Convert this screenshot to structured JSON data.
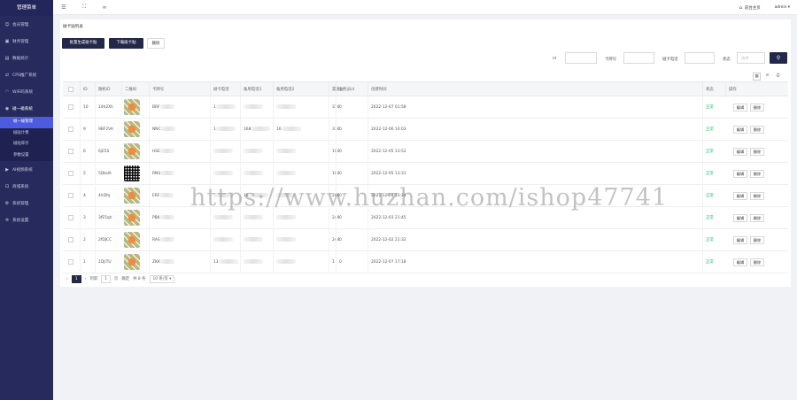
{
  "sidebar": {
    "title": "管理菜单",
    "items": [
      {
        "label": "会员管理",
        "icon": "user-group-icon"
      },
      {
        "label": "财务管理",
        "icon": "wallet-icon"
      },
      {
        "label": "数据统计",
        "icon": "chart-icon"
      },
      {
        "label": "CPS推广系统",
        "icon": "share-icon"
      },
      {
        "label": "WiFi码系统",
        "icon": "wifi-icon"
      },
      {
        "label": "碰一碰系统",
        "icon": "nfc-icon",
        "active": true
      },
      {
        "label": "AI视频系统",
        "icon": "video-icon"
      },
      {
        "label": "商城系统",
        "icon": "cart-icon"
      },
      {
        "label": "系统管理",
        "icon": "gear-icon"
      },
      {
        "label": "系统设置",
        "icon": "settings-icon"
      }
    ],
    "submenu": [
      "碰一碰管理",
      "碰贴计费",
      "碰贴库存",
      "参数设置"
    ],
    "active_sub": "碰一碰管理"
  },
  "topbar": {
    "icons": [
      "menu-icon",
      "fullscreen-icon",
      "link-icon"
    ],
    "home_label": "前台主页",
    "user_label": "admin"
  },
  "page": {
    "title": "碰卡贴列表",
    "buttons": {
      "batch_generate": "批量生成碰卡贴",
      "download": "下载碰卡贴",
      "delete": "删除"
    },
    "filters": {
      "id_label": "id",
      "card_label": "卡牌号",
      "phone_label": "碰卡电话",
      "status_label": "状态",
      "status_placeholder": "选择"
    }
  },
  "table": {
    "headers": [
      "ID",
      "随机ID",
      "二维码",
      "卡牌号",
      "碰卡电话",
      "备用电话1",
      "备用电话2",
      "渠道id",
      "业务员id",
      "创建时间",
      "状态",
      "操作"
    ],
    "rows": [
      {
        "id": "10",
        "rid": "10h2Xh",
        "card": "BRF",
        "phone": "1",
        "b1": "",
        "b2": "",
        "ch": "310",
        "sales": "0",
        "time": "2022-12-07 01:58",
        "status": "正常",
        "qr": "color"
      },
      {
        "id": "9",
        "rid": "9BF2VA",
        "card": "NNC",
        "phone": "1",
        "b1": "168",
        "b2": "16",
        "ch": "330",
        "sales": "0",
        "time": "2022-12-06 14:03",
        "status": "正常",
        "qr": "color"
      },
      {
        "id": "6",
        "rid": "6jE5S",
        "card": "HSE",
        "phone": "",
        "b1": "",
        "b2": "",
        "ch": "102",
        "sales": "0",
        "time": "2022-12-05 13:52",
        "status": "正常",
        "qr": "color"
      },
      {
        "id": "5",
        "rid": "5DbdA",
        "card": "RNS",
        "phone": "",
        "b1": "",
        "b2": "",
        "ch": "103",
        "sales": "0",
        "time": "2022-12-05 13:31",
        "status": "正常",
        "qr": "bw"
      },
      {
        "id": "4",
        "rid": "4hDfq",
        "card": "ERF",
        "phone": "",
        "b1": "16",
        "b2": "",
        "ch": "204",
        "sales": "0",
        "time": "2022-12-04 13:24",
        "status": "正常",
        "qr": "color"
      },
      {
        "id": "3",
        "rid": "3fE5qh",
        "card": "PBK",
        "phone": "",
        "b1": "",
        "b2": "",
        "ch": "249",
        "sales": "0",
        "time": "2022-12-03 21:45",
        "status": "正常",
        "qr": "color"
      },
      {
        "id": "2",
        "rid": "2fDJCC",
        "card": "RAS",
        "phone": "",
        "b1": "",
        "b2": "",
        "ch": "244",
        "sales": "0",
        "time": "2022-12-02 21:32",
        "status": "正常",
        "qr": "color"
      },
      {
        "id": "1",
        "rid": "1DJiTU",
        "card": "ZKK",
        "phone": "13",
        "b1": "",
        "b2": "",
        "ch": "1",
        "sales": "0",
        "time": "2022-12-07 17:18",
        "status": "正常",
        "qr": "color"
      }
    ],
    "op_edit": "编辑",
    "op_delete": "删除"
  },
  "pager": {
    "current": "1",
    "goto_label": "到第",
    "page_input": "1",
    "page_unit": "页",
    "confirm": "确定",
    "total": "共 8 条",
    "page_size": "10 条/页"
  },
  "watermark": "https://www.huzhan.com/ishop47741"
}
